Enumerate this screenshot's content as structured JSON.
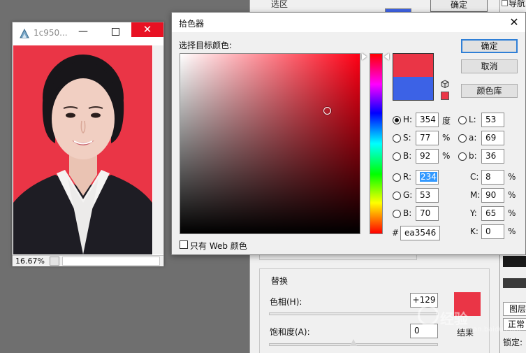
{
  "background_panel": {
    "select_label": "选区",
    "ok_label": "确定",
    "replace_group_title": "替换",
    "hue_label": "色相(H):",
    "hue_value": "+129",
    "saturation_label": "饱和度(A):",
    "saturation_value": "0",
    "result_label": "结果",
    "result_color": "#ea3546"
  },
  "right_edge": {
    "layers_tab": "图层",
    "blend_mode": "正常",
    "lock_label": "锁定:",
    "top_label": "导航"
  },
  "watermark": {
    "text": "经验",
    "sub": "jingyan.baidu.com"
  },
  "document_window": {
    "title": "1c950...",
    "minimize_glyph": "—",
    "close_glyph": "✕",
    "zoom": "16.67%",
    "background_color": "#ea3546"
  },
  "color_picker": {
    "title": "拾色器",
    "close_glyph": "✕",
    "select_target_label": "选择目标颜色:",
    "only_web_colors_label": "只有 Web 颜色",
    "ok_label": "确定",
    "cancel_label": "取消",
    "library_label": "颜色库",
    "new_color": "#ea3546",
    "old_color": "#3c62e6",
    "hue_selected": true,
    "fields": {
      "H": {
        "label": "H:",
        "value": "354",
        "unit": "度"
      },
      "S": {
        "label": "S:",
        "value": "77",
        "unit": "%"
      },
      "B": {
        "label": "B:",
        "value": "92",
        "unit": "%"
      },
      "L": {
        "label": "L:",
        "value": "53"
      },
      "a": {
        "label": "a:",
        "value": "69"
      },
      "b": {
        "label": "b:",
        "value": "36"
      },
      "R": {
        "label": "R:",
        "value": "234"
      },
      "G": {
        "label": "G:",
        "value": "53"
      },
      "Bl": {
        "label": "B:",
        "value": "70"
      },
      "C": {
        "label": "C:",
        "value": "8",
        "unit": "%"
      },
      "M": {
        "label": "M:",
        "value": "90",
        "unit": "%"
      },
      "Y": {
        "label": "Y:",
        "value": "65",
        "unit": "%"
      },
      "K": {
        "label": "K:",
        "value": "0",
        "unit": "%"
      },
      "hex": {
        "label": "#",
        "value": "ea3546"
      }
    }
  }
}
